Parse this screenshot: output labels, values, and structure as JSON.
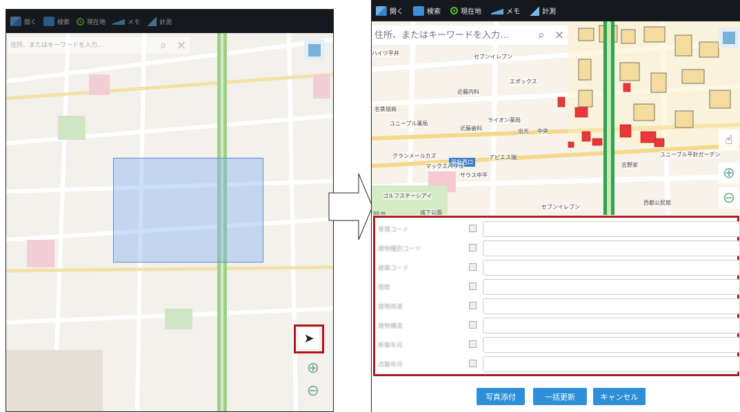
{
  "left_panel": {
    "toolbar": [
      "開く",
      "検索",
      "現在地",
      "メモ",
      "計測"
    ],
    "search_placeholder": "住所、またはキーワードを入力..."
  },
  "right_panel": {
    "toolbar": [
      {
        "label": "開く",
        "icon": "open-icon"
      },
      {
        "label": "検索",
        "icon": "search-icon"
      },
      {
        "label": "現在地",
        "icon": "location-icon"
      },
      {
        "label": "メモ",
        "icon": "memo-icon"
      },
      {
        "label": "計測",
        "icon": "measure-icon"
      }
    ],
    "search_placeholder": "住所、またはキーワードを入力...",
    "map_labels": [
      "ハイツ平井",
      "セブンイレブン",
      "エポックス",
      "近藤内科",
      "名鉄協商",
      "ユニーブル薬局",
      "ライオン薬局",
      "近藤歯科",
      "出光",
      "中央",
      "平針西口",
      "グランメールカズ",
      "アピエス瑞",
      "マックスバリュ",
      "サウス中平",
      "ゴルフステーシアイ",
      "城下公園",
      "セブンイレブン",
      "西都公民館",
      "ユニーブル平針ガーデン",
      "吉野家"
    ],
    "scale": "50 m",
    "form_rows": [
      "管理コード",
      "建物種別コード",
      "建築コード",
      "階数",
      "建物用途",
      "建物構造",
      "新築年月",
      "改築年月"
    ],
    "buttons": {
      "photo": "写真添付",
      "bulk_update": "一括更新",
      "cancel": "キャンセル"
    }
  },
  "colors": {
    "toolbar": "#15181c",
    "accent": "#2d8fd7",
    "highlight": "#b5121b"
  }
}
